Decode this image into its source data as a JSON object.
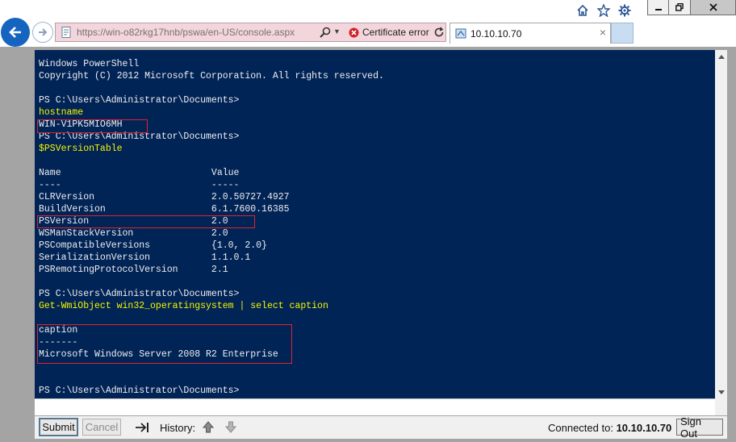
{
  "browser": {
    "address_url": "https://win-o82rkg17hnb/pswa/en-US/console.aspx",
    "cert_error": "Certificate error",
    "tab_title": "10.10.10.70",
    "tab_close": "×"
  },
  "console": {
    "lines": [
      {
        "text": "Windows PowerShell",
        "kind": "out"
      },
      {
        "text": "Copyright (C) 2012 Microsoft Corporation. All rights reserved.",
        "kind": "out"
      },
      {
        "text": "",
        "kind": "out"
      },
      {
        "text": "PS C:\\Users\\Administrator\\Documents>",
        "kind": "out"
      },
      {
        "text": "hostname",
        "kind": "cmd"
      },
      {
        "text": "WIN-V1PK5MIO6MH",
        "kind": "out"
      },
      {
        "text": "PS C:\\Users\\Administrator\\Documents>",
        "kind": "out"
      },
      {
        "text": "$PSVersionTable",
        "kind": "cmd"
      },
      {
        "text": "",
        "kind": "out"
      },
      {
        "text": "Name                           Value",
        "kind": "out"
      },
      {
        "text": "----                           -----",
        "kind": "out"
      },
      {
        "text": "CLRVersion                     2.0.50727.4927",
        "kind": "out"
      },
      {
        "text": "BuildVersion                   6.1.7600.16385",
        "kind": "out"
      },
      {
        "text": "PSVersion                      2.0",
        "kind": "out"
      },
      {
        "text": "WSManStackVersion              2.0",
        "kind": "out"
      },
      {
        "text": "PSCompatibleVersions           {1.0, 2.0}",
        "kind": "out"
      },
      {
        "text": "SerializationVersion           1.1.0.1",
        "kind": "out"
      },
      {
        "text": "PSRemotingProtocolVersion      2.1",
        "kind": "out"
      },
      {
        "text": "",
        "kind": "out"
      },
      {
        "text": "PS C:\\Users\\Administrator\\Documents>",
        "kind": "out"
      },
      {
        "text": "Get-WmiObject win32_operatingsystem | select caption",
        "kind": "cmd"
      },
      {
        "text": "",
        "kind": "out"
      },
      {
        "text": "caption",
        "kind": "out"
      },
      {
        "text": "-------",
        "kind": "out"
      },
      {
        "text": "Microsoft Windows Server 2008 R2 Enterprise",
        "kind": "out"
      },
      {
        "text": "",
        "kind": "out"
      },
      {
        "text": "",
        "kind": "out"
      },
      {
        "text": "PS C:\\Users\\Administrator\\Documents>",
        "kind": "out"
      }
    ],
    "input_value": ""
  },
  "toolbar": {
    "submit_label": "Submit",
    "cancel_label": "Cancel",
    "history_label": "History:",
    "connected_label": "Connected to:",
    "connected_host": "10.10.10.70",
    "signout_label": "Sign Out"
  },
  "colors": {
    "console_bg": "#012456",
    "console_text": "#eeedf0",
    "command_text": "#f5f500",
    "highlight": "#e0222c",
    "address_bar_error": "#f3d6dc"
  },
  "icons": [
    "home-icon",
    "favorites-star-icon",
    "settings-gear-icon",
    "back-arrow-icon",
    "forward-arrow-icon",
    "page-icon",
    "search-icon",
    "certificate-error-icon",
    "refresh-icon",
    "tab-favicon",
    "tab-key-icon",
    "history-up-icon",
    "history-down-icon"
  ]
}
